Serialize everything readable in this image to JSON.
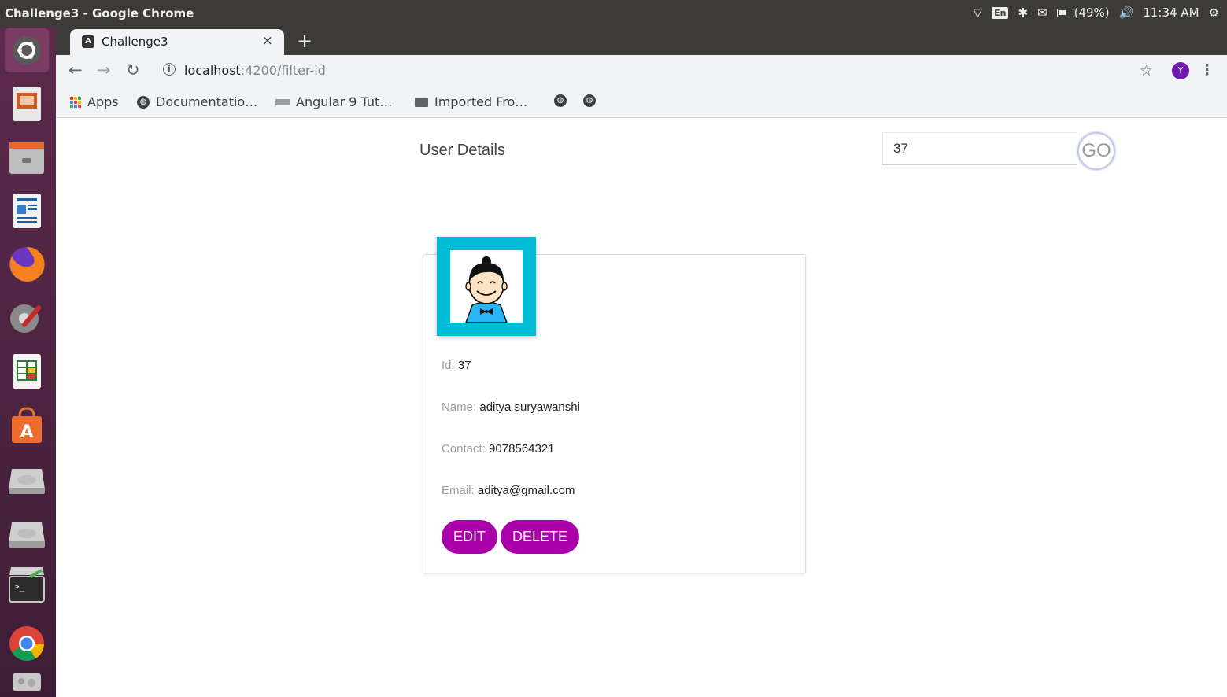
{
  "os_panel": {
    "window_title": "Challenge3 - Google Chrome",
    "lang": "En",
    "battery": "(49%)",
    "time": "11:34 AM"
  },
  "launcher": {
    "items": [
      "ubuntu-dash-icon",
      "impress-icon",
      "files-icon",
      "writer-icon",
      "firefox-icon",
      "settings-icon",
      "calc-icon",
      "software-center-icon",
      "drive-icon",
      "drive-icon",
      "terminal-icon",
      "chrome-icon",
      "trash-icon"
    ]
  },
  "browser": {
    "tab_title": "Challenge3",
    "tab_close": "×",
    "new_tab": "+",
    "url_host": "localhost",
    "url_rest": ":4200/filter-id",
    "profile_initial": "Y",
    "bookmarks": [
      "Apps",
      "Documentatio…",
      "Angular 9 Tut…",
      "Imported Fro…"
    ]
  },
  "page": {
    "title": "User Details",
    "search_value": "37",
    "go_label": "GO",
    "user": {
      "id_label": "Id:",
      "id": "37",
      "name_label": "Name:",
      "name": "aditya suryawanshi",
      "contact_label": "Contact:",
      "contact": "9078564321",
      "email_label": "Email:",
      "email": "aditya@gmail.com"
    },
    "edit_label": "EDIT",
    "delete_label": "DELETE"
  },
  "colors": {
    "accent_button": "#aa00aa",
    "avatar_frame": "#00bcd4",
    "panel": "#3c3b37"
  }
}
